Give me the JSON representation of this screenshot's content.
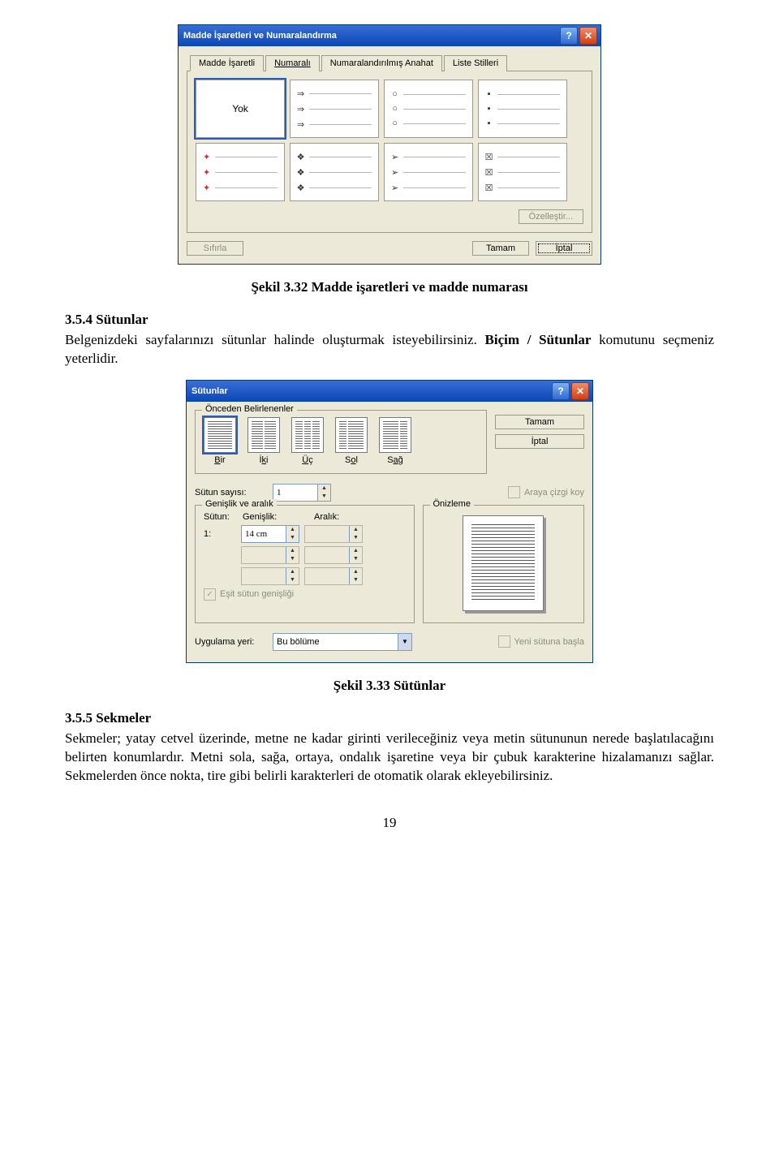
{
  "dialog1": {
    "title": "Madde İşaretleri ve Numaralandırma",
    "tabs": [
      "Madde İşaretli",
      "Numaralı",
      "Numaralandırılmış Anahat",
      "Liste Stilleri"
    ],
    "none_label": "Yok",
    "customize": "Özelleştir...",
    "reset": "Sıfırla",
    "ok": "Tamam",
    "cancel": "İptal"
  },
  "caption1": "Şekil 3.32 Madde işaretleri ve madde numarası",
  "sec354_title": "3.5.4 Sütunlar",
  "sec354_body": "Belgenizdeki sayfalarınızı sütunlar halinde oluşturmak isteyebilirsiniz. Biçim / Sütunlar komutunu seçmeniz yeterlidir.",
  "dialog2": {
    "title": "Sütunlar",
    "presets_legend": "Önceden Belirlenenler",
    "preset_labels": [
      "Bir",
      "İki",
      "Üç",
      "Sol",
      "Sağ"
    ],
    "ok": "Tamam",
    "cancel": "İptal",
    "col_count_label": "Sütun sayısı:",
    "col_count_value": "1",
    "line_between": "Araya çizgi koy",
    "width_legend": "Genişlik ve aralık",
    "col_hdr": "Sütun:",
    "width_hdr": "Genişlik:",
    "spacing_hdr": "Aralık:",
    "row1_col": "1:",
    "row1_width": "14 cm",
    "equal": "Eşit sütun genişliği",
    "preview_legend": "Önizleme",
    "apply_label": "Uygulama yeri:",
    "apply_value": "Bu bölüme",
    "new_col": "Yeni sütuna başla"
  },
  "caption2": "Şekil 3.33 Sütünlar",
  "sec355_title": "3.5.5 Sekmeler",
  "sec355_body": "Sekmeler; yatay cetvel üzerinde, metne ne kadar girinti verileceğiniz veya metin sütununun nerede başlatılacağını belirten konumlardır. Metni sola, sağa, ortaya, ondalık işaretine veya bir çubuk karakterine hizalamanızı sağlar. Sekmelerden önce nokta, tire gibi belirli karakterleri de otomatik olarak ekleyebilirsiniz.",
  "page_number": "19"
}
